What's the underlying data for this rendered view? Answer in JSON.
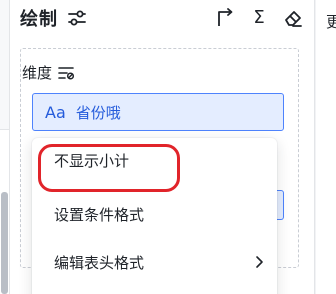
{
  "panel": {
    "title": "绘制",
    "tools": [
      "settings-sliders-icon",
      "corner-arrow-icon",
      "sum-icon",
      "eraser-icon"
    ],
    "sigma": "Σ"
  },
  "dimension": {
    "label": "维度",
    "filter_icon": "filter-list-icon",
    "field": {
      "type_badge": "Aa",
      "name": "省份哦"
    }
  },
  "context_menu": {
    "items": [
      {
        "label": "不显示小计",
        "highlighted": true
      },
      {
        "label": "设置条件格式",
        "highlighted": false
      },
      {
        "label": "编辑表头格式",
        "has_submenu": true
      }
    ]
  },
  "right_pane": {
    "peek_text": "更"
  },
  "colors": {
    "accent": "#245bdb",
    "chip_bg": "#e4edff",
    "chip_border": "#4e83fd",
    "highlight": "#e1242a"
  }
}
